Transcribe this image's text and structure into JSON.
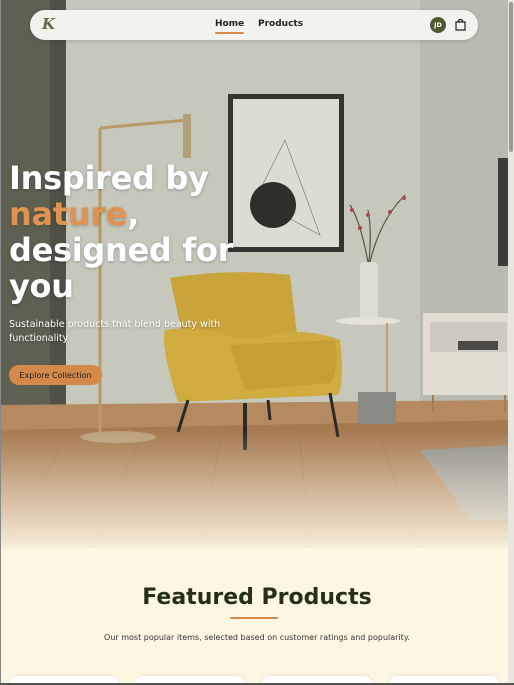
{
  "nav": {
    "logo": "K",
    "links": [
      "Home",
      "Products"
    ],
    "avatar_initials": "JD",
    "cart_icon": "shopping-bag-icon"
  },
  "hero": {
    "headline_line1": "Inspired by",
    "headline_accent": "nature",
    "headline_comma": ",",
    "headline_line3": "designed for",
    "headline_line4": "you",
    "subtitle": "Sustainable products that blend beauty with functionality",
    "cta_label": "Explore Collection"
  },
  "featured": {
    "title": "Featured Products",
    "subtitle": "Our most popular items, selected based on customer ratings and popularity."
  },
  "colors": {
    "accent": "#d4894a",
    "brand_dark": "#4b5a2f",
    "background": "#fdf6e3"
  }
}
